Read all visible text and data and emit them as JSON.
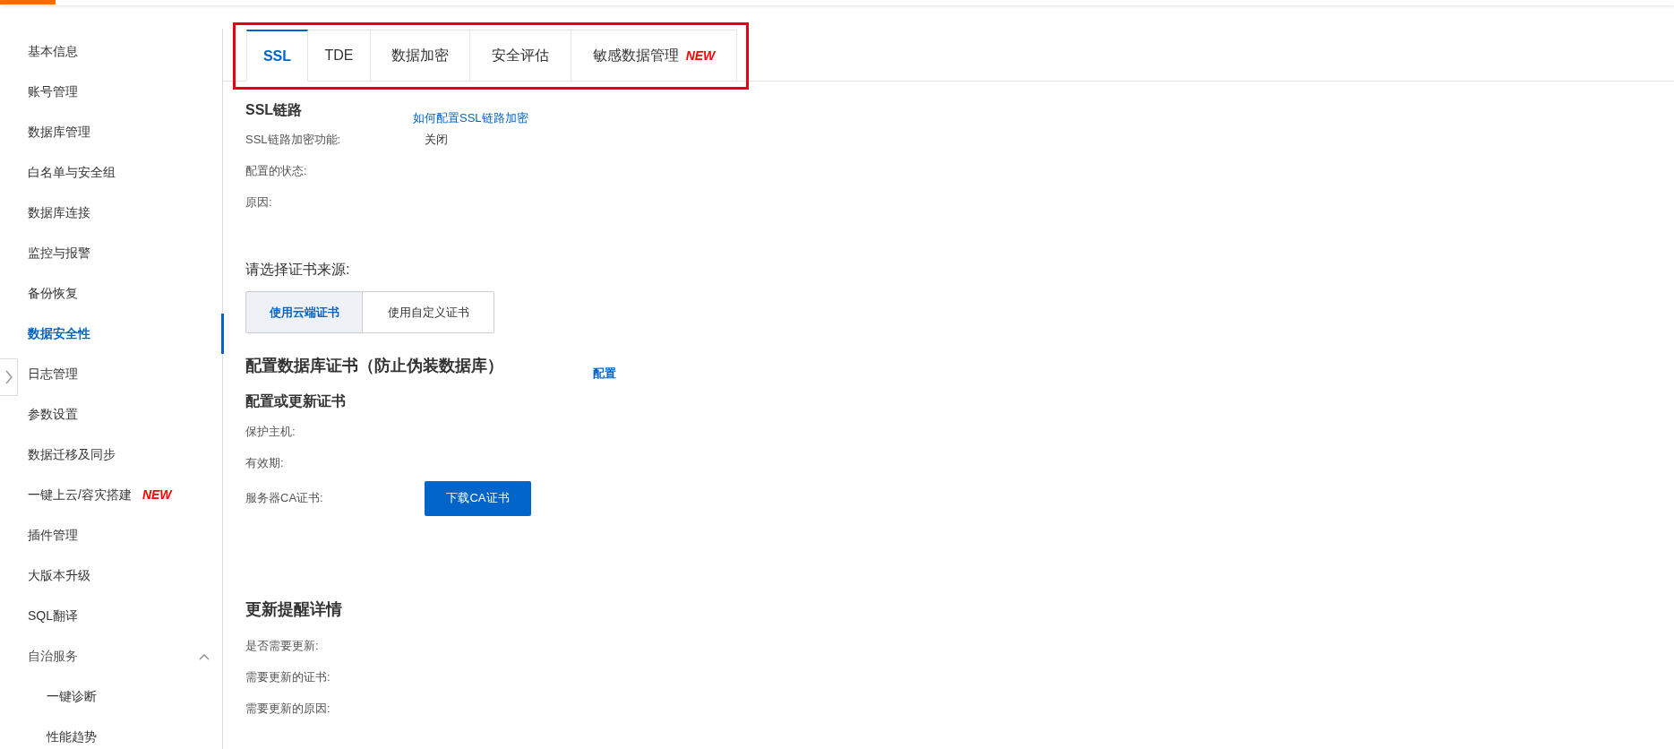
{
  "sidebar": {
    "items": [
      {
        "label": "基本信息",
        "selected": false
      },
      {
        "label": "账号管理",
        "selected": false
      },
      {
        "label": "数据库管理",
        "selected": false
      },
      {
        "label": "白名单与安全组",
        "selected": false
      },
      {
        "label": "数据库连接",
        "selected": false
      },
      {
        "label": "监控与报警",
        "selected": false
      },
      {
        "label": "备份恢复",
        "selected": false
      },
      {
        "label": "数据安全性",
        "selected": true
      },
      {
        "label": "日志管理",
        "selected": false
      },
      {
        "label": "参数设置",
        "selected": false
      },
      {
        "label": "数据迁移及同步",
        "selected": false
      },
      {
        "label": "一键上云/容灾搭建",
        "selected": false,
        "badge": "NEW"
      },
      {
        "label": "插件管理",
        "selected": false
      },
      {
        "label": "大版本升级",
        "selected": false
      },
      {
        "label": "SQL翻译",
        "selected": false
      },
      {
        "label": "自治服务",
        "selected": false,
        "expanded": true,
        "children": [
          {
            "label": "一键诊断",
            "selected": false
          },
          {
            "label": "性能趋势",
            "selected": false
          }
        ]
      }
    ]
  },
  "tabs": [
    {
      "label": "SSL",
      "selected": true
    },
    {
      "label": "TDE",
      "selected": false
    },
    {
      "label": "数据加密",
      "selected": false
    },
    {
      "label": "安全评估",
      "selected": false
    },
    {
      "label": "敏感数据管理",
      "selected": false,
      "badge": "NEW"
    }
  ],
  "ssl": {
    "title": "SSL链路",
    "help_link": "如何配置SSL链路加密",
    "fields": [
      {
        "label": "SSL链路加密功能:",
        "value": "关闭"
      },
      {
        "label": "配置的状态:"
      },
      {
        "label": "原因:"
      }
    ]
  },
  "certificate_source": {
    "label": "请选择证书来源:",
    "options": [
      {
        "label": "使用云端证书",
        "selected": true
      },
      {
        "label": "使用自定义证书",
        "selected": false
      }
    ]
  },
  "db_certificate": {
    "title": "配置数据库证书（防止伪装数据库）",
    "action_link": "配置",
    "subtitle": "配置或更新证书",
    "fields": [
      {
        "label": "保护主机:"
      },
      {
        "label": "有效期:"
      },
      {
        "label": "服务器CA证书:",
        "button": "下载CA证书"
      }
    ]
  },
  "update_reminder": {
    "title": "更新提醒详情",
    "fields": [
      {
        "label": "是否需要更新:"
      },
      {
        "label": "需要更新的证书:"
      },
      {
        "label": "需要更新的原因:"
      }
    ]
  }
}
